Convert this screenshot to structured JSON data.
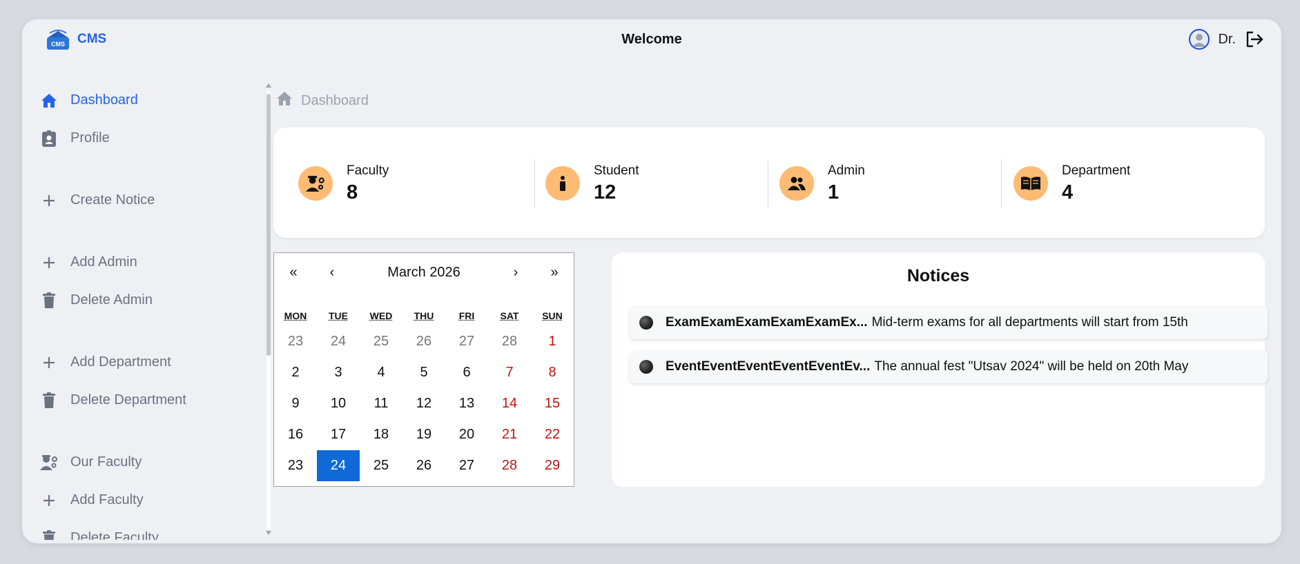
{
  "app": {
    "logo_text": "CMS",
    "welcome": "Welcome",
    "user_name": "Dr."
  },
  "sidebar": {
    "items": [
      {
        "label": "Dashboard",
        "icon": "home-icon",
        "active": true
      },
      {
        "label": "Profile",
        "icon": "id-badge-icon"
      },
      {
        "label": "Create Notice",
        "icon": "plus-icon"
      },
      {
        "label": "Add Admin",
        "icon": "plus-icon"
      },
      {
        "label": "Delete Admin",
        "icon": "trash-icon"
      },
      {
        "label": "Add Department",
        "icon": "plus-icon"
      },
      {
        "label": "Delete Department",
        "icon": "trash-icon"
      },
      {
        "label": "Our Faculty",
        "icon": "faculty-icon"
      },
      {
        "label": "Add Faculty",
        "icon": "plus-icon"
      },
      {
        "label": "Delete Faculty",
        "icon": "trash-icon"
      }
    ]
  },
  "breadcrumb": {
    "label": "Dashboard"
  },
  "stats": [
    {
      "label": "Faculty",
      "value": "8",
      "icon": "faculty-icon"
    },
    {
      "label": "Student",
      "value": "12",
      "icon": "student-icon"
    },
    {
      "label": "Admin",
      "value": "1",
      "icon": "users-icon"
    },
    {
      "label": "Department",
      "value": "4",
      "icon": "book-icon"
    }
  ],
  "calendar": {
    "month_label": "March 2026",
    "nav": {
      "prev_year": "«",
      "prev_month": "‹",
      "next_month": "›",
      "next_year": "»"
    },
    "weekdays": [
      "MON",
      "TUE",
      "WED",
      "THU",
      "FRI",
      "SAT",
      "SUN"
    ],
    "days": [
      {
        "d": "23",
        "other": true
      },
      {
        "d": "24",
        "other": true
      },
      {
        "d": "25",
        "other": true
      },
      {
        "d": "26",
        "other": true
      },
      {
        "d": "27",
        "other": true
      },
      {
        "d": "28",
        "other": true
      },
      {
        "d": "1"
      },
      {
        "d": "2"
      },
      {
        "d": "3"
      },
      {
        "d": "4"
      },
      {
        "d": "5"
      },
      {
        "d": "6"
      },
      {
        "d": "7"
      },
      {
        "d": "8"
      },
      {
        "d": "9"
      },
      {
        "d": "10"
      },
      {
        "d": "11"
      },
      {
        "d": "12"
      },
      {
        "d": "13"
      },
      {
        "d": "14"
      },
      {
        "d": "15"
      },
      {
        "d": "16"
      },
      {
        "d": "17"
      },
      {
        "d": "18"
      },
      {
        "d": "19"
      },
      {
        "d": "20"
      },
      {
        "d": "21"
      },
      {
        "d": "22"
      },
      {
        "d": "23"
      },
      {
        "d": "24",
        "today": true
      },
      {
        "d": "25"
      },
      {
        "d": "26"
      },
      {
        "d": "27"
      },
      {
        "d": "28"
      },
      {
        "d": "29"
      }
    ],
    "colors": {
      "today_bg": "#0f6ad8",
      "weekend": "#c01414"
    }
  },
  "notices": {
    "title": "Notices",
    "items": [
      {
        "title": "ExamExamExamExamExamEx...",
        "text": "Mid-term exams for all departments will start from 15th"
      },
      {
        "title": "EventEventEventEventEventEv...",
        "text": "The annual fest \"Utsav 2024\" will be held on 20th May"
      }
    ]
  },
  "colors": {
    "accent": "#2563eb",
    "stat_icon_bg": "#fdbb74"
  }
}
